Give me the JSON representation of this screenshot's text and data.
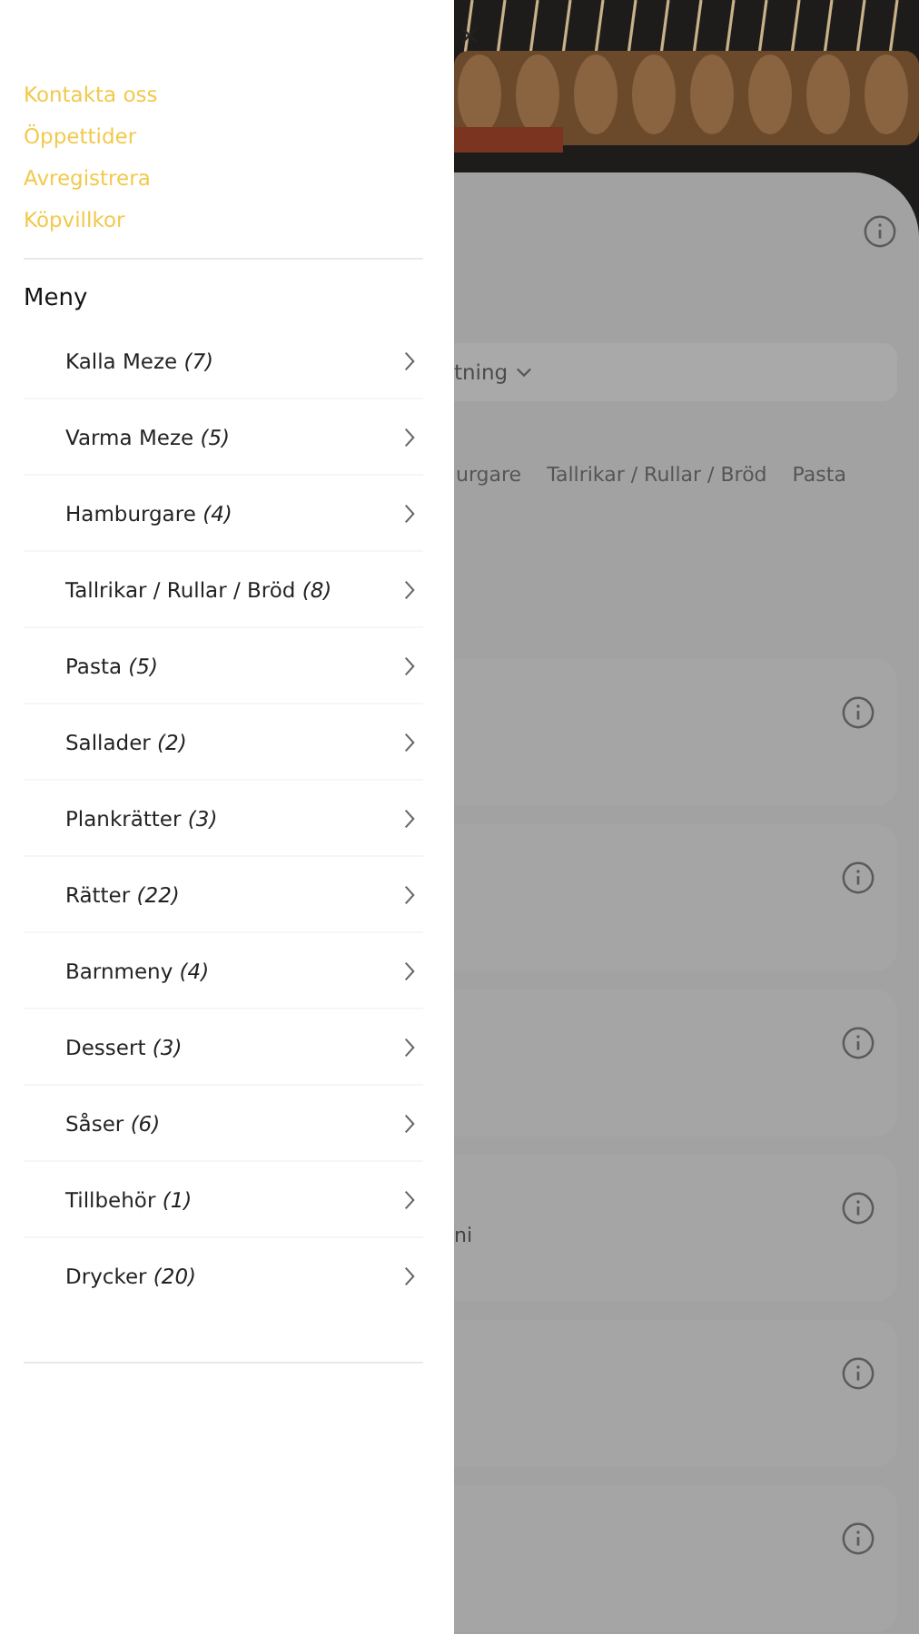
{
  "drawer": {
    "links": [
      "Kontakta oss",
      "Öppettider",
      "Avregistrera",
      "Köpvillkor"
    ],
    "section_title": "Meny",
    "menu_items": [
      {
        "label": "Kalla Meze *(7)*"
      },
      {
        "label": "Varma Meze *(5)*"
      },
      {
        "label": "Hamburgare *(4)*"
      },
      {
        "label": "Tallrikar / Rullar / Bröd *(8)*"
      },
      {
        "label": "Pasta *(5)*"
      },
      {
        "label": "Sallader *(2)*"
      },
      {
        "label": "Plankrätter *(3)*"
      },
      {
        "label": "Rätter *(22)*"
      },
      {
        "label": "Barnmeny *(4)*"
      },
      {
        "label": "Dessert *(3)*"
      },
      {
        "label": "Såser *(6)*"
      },
      {
        "label": "Tillbehör *(1)*"
      },
      {
        "label": "Drycker *(20)*"
      }
    ]
  },
  "background": {
    "filter_label": "tning",
    "category_tabs": [
      "urgare",
      "Tallrikar / Rullar / Bröd",
      "Pasta"
    ],
    "cards": [
      {
        "kind": "plain"
      },
      {
        "kind": "plain"
      },
      {
        "kind": "plain"
      },
      {
        "kind": "text",
        "text": "ni"
      },
      {
        "kind": "plain"
      },
      {
        "kind": "plain"
      }
    ]
  }
}
